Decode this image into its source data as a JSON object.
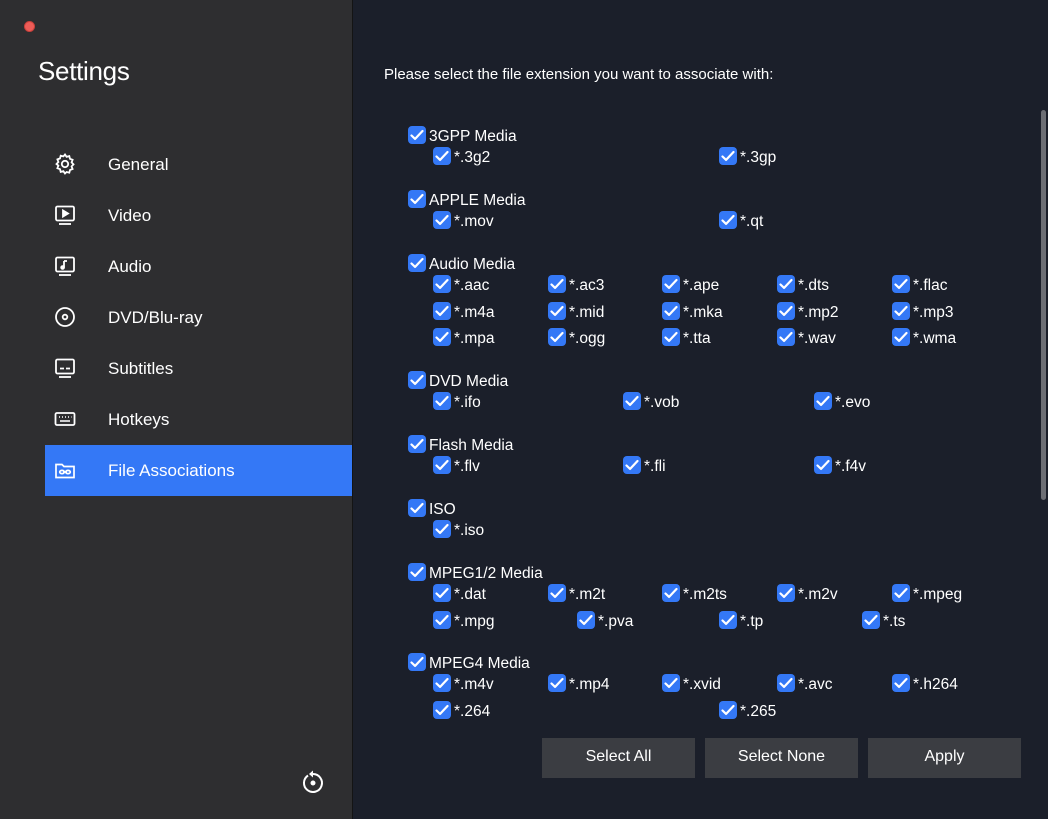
{
  "colors": {
    "accent": "#3478f6",
    "sidebar_bg": "#2e2e30",
    "main_bg": "#1b1f2a",
    "button_bg": "#3b3d42",
    "close": "#ed5c57"
  },
  "sidebar": {
    "title": "Settings",
    "items": [
      {
        "label": "General",
        "icon": "gear-icon",
        "active": false
      },
      {
        "label": "Video",
        "icon": "video-icon",
        "active": false
      },
      {
        "label": "Audio",
        "icon": "audio-icon",
        "active": false
      },
      {
        "label": "DVD/Blu-ray",
        "icon": "disc-icon",
        "active": false
      },
      {
        "label": "Subtitles",
        "icon": "subtitles-icon",
        "active": false
      },
      {
        "label": "Hotkeys",
        "icon": "keyboard-icon",
        "active": false
      },
      {
        "label": "File Associations",
        "icon": "folder-link-icon",
        "active": true
      }
    ],
    "reset_icon": "reset-icon"
  },
  "main": {
    "prompt": "Please select the file extension you want to associate with:",
    "groups": [
      {
        "name": "3GPP Media",
        "checked": true,
        "rows": [
          [
            "*.3g2",
            "*.3gp"
          ]
        ]
      },
      {
        "name": "APPLE Media",
        "checked": true,
        "rows": [
          [
            "*.mov",
            "*.qt"
          ]
        ]
      },
      {
        "name": "Audio Media",
        "checked": true,
        "rows": [
          [
            "*.aac",
            "*.ac3",
            "*.ape",
            "*.dts",
            "*.flac"
          ],
          [
            "*.m4a",
            "*.mid",
            "*.mka",
            "*.mp2",
            "*.mp3"
          ],
          [
            "*.mpa",
            "*.ogg",
            "*.tta",
            "*.wav",
            "*.wma"
          ]
        ]
      },
      {
        "name": "DVD Media",
        "checked": true,
        "rows": [
          [
            "*.ifo",
            "*.vob",
            "*.evo"
          ]
        ]
      },
      {
        "name": "Flash Media",
        "checked": true,
        "rows": [
          [
            "*.flv",
            "*.fli",
            "*.f4v"
          ]
        ]
      },
      {
        "name": "ISO",
        "checked": true,
        "rows": [
          [
            "*.iso"
          ]
        ]
      },
      {
        "name": "MPEG1/2 Media",
        "checked": true,
        "rows": [
          [
            "*.dat",
            "*.m2t",
            "*.m2ts",
            "*.m2v",
            "*.mpeg"
          ],
          [
            "*.mpg",
            "*.pva",
            "*.tp",
            "*.ts"
          ]
        ]
      },
      {
        "name": "MPEG4 Media",
        "checked": true,
        "rows": [
          [
            "*.m4v",
            "*.mp4",
            "*.xvid",
            "*.avc",
            "*.h264"
          ],
          [
            "*.264",
            "*.265"
          ]
        ]
      }
    ],
    "buttons": {
      "select_all": "Select All",
      "select_none": "Select None",
      "apply": "Apply"
    }
  }
}
